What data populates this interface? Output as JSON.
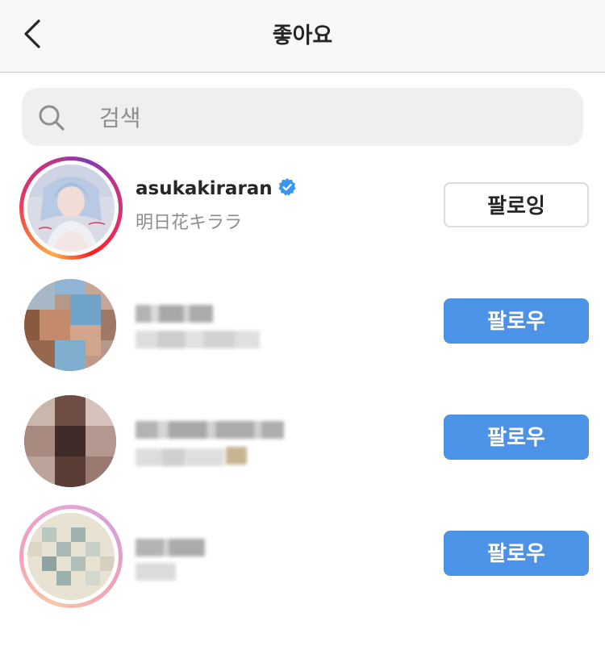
{
  "header": {
    "title": "좋아요",
    "back_icon": "chevron-left-icon"
  },
  "search": {
    "placeholder": "검색",
    "icon": "search-icon"
  },
  "colors": {
    "follow_button": "#4c93e8",
    "verified_badge": "#3897f0",
    "header_bg": "#f8f8f8",
    "search_bg": "#efefef"
  },
  "likers": [
    {
      "username": "asukakiraran",
      "full_name": "明日花キララ",
      "verified": true,
      "has_story": true,
      "button_label": "팔로잉"
    },
    {
      "username": "",
      "full_name": "",
      "verified": false,
      "has_story": false,
      "button_label": "팔로우"
    },
    {
      "username": "",
      "full_name": "",
      "verified": false,
      "has_story": false,
      "button_label": "팔로우"
    },
    {
      "username": "",
      "full_name": "",
      "verified": false,
      "has_story": true,
      "button_label": "팔로우"
    }
  ]
}
